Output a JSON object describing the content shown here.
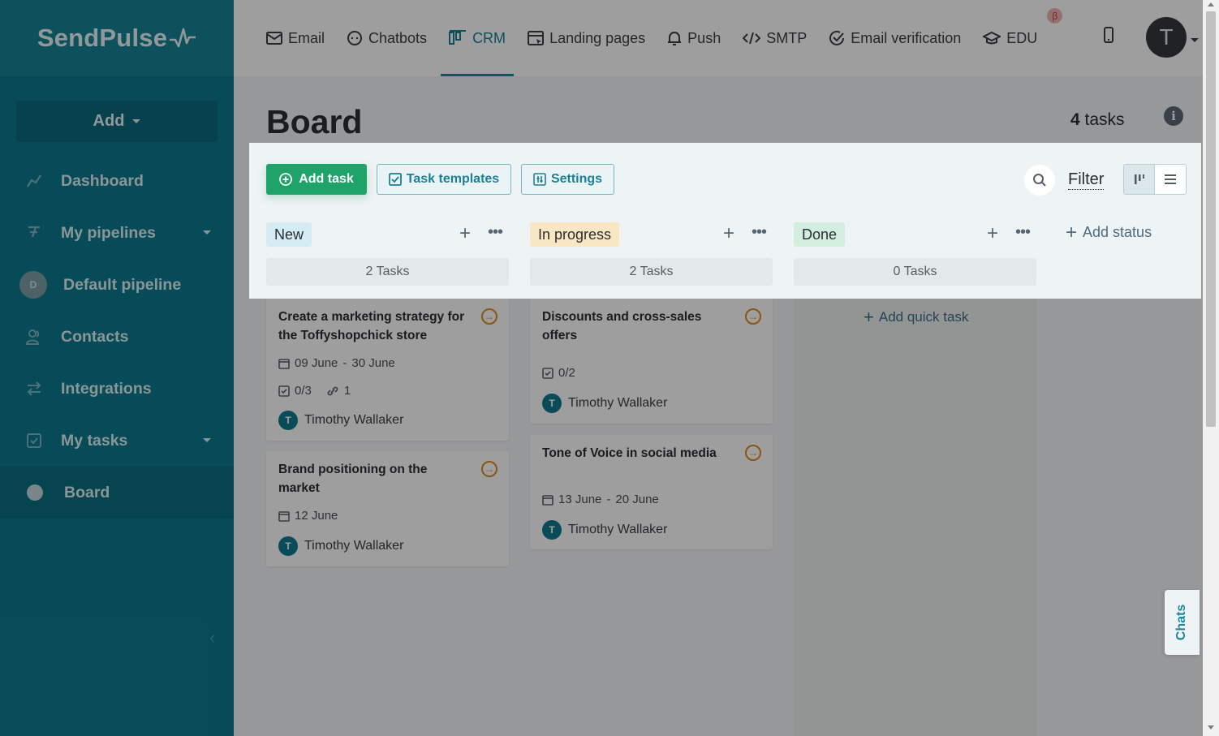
{
  "brand": {
    "logo_text": "SendPulse"
  },
  "sidebar": {
    "add_label": "Add",
    "items": [
      {
        "label": "Dashboard"
      },
      {
        "label": "My pipelines"
      },
      {
        "label": "Default pipeline",
        "avatar": "D"
      },
      {
        "label": "Contacts"
      },
      {
        "label": "Integrations"
      },
      {
        "label": "My tasks"
      },
      {
        "label": "Board"
      }
    ]
  },
  "topnav": {
    "items": [
      {
        "label": "Email"
      },
      {
        "label": "Chatbots"
      },
      {
        "label": "CRM"
      },
      {
        "label": "Landing pages"
      },
      {
        "label": "Push"
      },
      {
        "label": "SMTP"
      },
      {
        "label": "Email verification"
      },
      {
        "label": "EDU",
        "badge": "β"
      }
    ],
    "active": "CRM",
    "user_initial": "T"
  },
  "page": {
    "title": "Board",
    "task_count": "4",
    "task_count_suffix": "tasks"
  },
  "toolbar": {
    "add_task": "Add task",
    "task_templates": "Task templates",
    "settings": "Settings",
    "filter": "Filter"
  },
  "columns": [
    {
      "status": "New",
      "count_label": "2 Tasks",
      "color": "#d6ecf5"
    },
    {
      "status": "In progress",
      "count_label": "2 Tasks",
      "color": "#f9e6c3"
    },
    {
      "status": "Done",
      "count_label": "0 Tasks",
      "color": "#d3eedf"
    }
  ],
  "add_status": "Add status",
  "add_quick_task": "Add quick task",
  "cards": {
    "new": [
      {
        "title": "Create a marketing strategy for the Toffyshopchick store",
        "date_start": "09 June",
        "date_sep": "-",
        "date_end": "30 June",
        "checklist": "0/3",
        "links": "1",
        "assignee": "Timothy Wallaker",
        "assignee_initial": "T"
      },
      {
        "title": "Brand positioning on the market",
        "date_start": "12 June",
        "assignee": "Timothy Wallaker",
        "assignee_initial": "T"
      }
    ],
    "in_progress": [
      {
        "title": "Discounts and cross-sales offers",
        "checklist": "0/2",
        "assignee": "Timothy Wallaker",
        "assignee_initial": "T"
      },
      {
        "title": "Tone of Voice in social media",
        "date_start": "13 June",
        "date_sep": "-",
        "date_end": "20 June",
        "assignee": "Timothy Wallaker",
        "assignee_initial": "T"
      }
    ]
  },
  "chats_tab": "Chats",
  "colors": {
    "sidebar": "#0d7a8f",
    "accent": "#1a8ca3",
    "add_task_green": "#1ea36a",
    "card_arrow": "#e08a20"
  }
}
